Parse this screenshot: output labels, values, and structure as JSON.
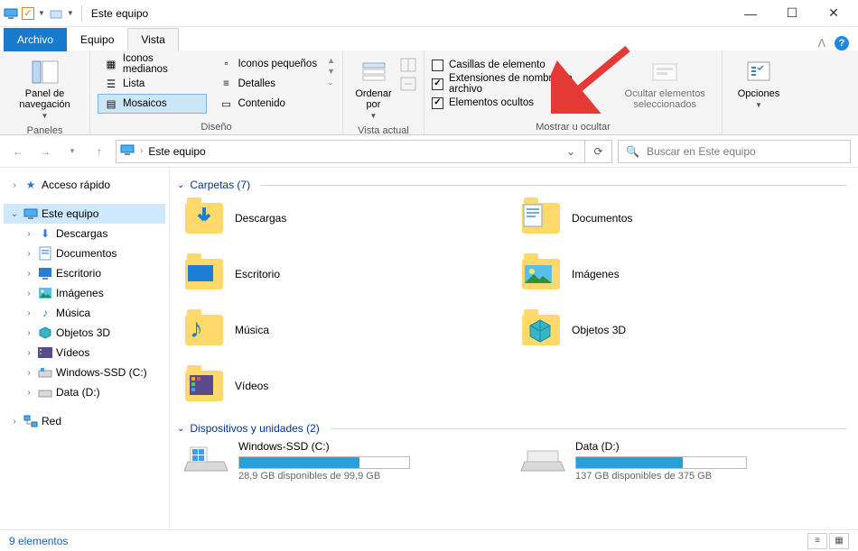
{
  "window": {
    "title": "Este equipo"
  },
  "tabs": {
    "file": "Archivo",
    "equipo": "Equipo",
    "vista": "Vista"
  },
  "ribbon": {
    "paneles": {
      "btn": "Panel de\nnavegación",
      "label": "Paneles"
    },
    "diseno": {
      "items": [
        "Iconos medianos",
        "Iconos pequeños",
        "Lista",
        "Detalles",
        "Mosaicos",
        "Contenido"
      ],
      "label": "Diseño"
    },
    "vista_actual": {
      "ordenar": "Ordenar\npor",
      "label": "Vista actual"
    },
    "mostrar": {
      "chk1": "Casillas de elemento",
      "chk2": "Extensiones de nombre de archivo",
      "chk3": "Elementos ocultos",
      "ocultar": "Ocultar elementos\nseleccionados",
      "label": "Mostrar u ocultar"
    },
    "opciones": "Opciones"
  },
  "nav": {
    "crumb": "Este equipo",
    "search_placeholder": "Buscar en Este equipo"
  },
  "tree": {
    "quick": "Acceso rápido",
    "pc": "Este equipo",
    "items": [
      "Descargas",
      "Documentos",
      "Escritorio",
      "Imágenes",
      "Música",
      "Objetos 3D",
      "Vídeos",
      "Windows-SSD (C:)",
      "Data (D:)"
    ],
    "red": "Red"
  },
  "sections": {
    "folders_hdr": "Carpetas (7)",
    "folders": [
      "Descargas",
      "Documentos",
      "Escritorio",
      "Imágenes",
      "Música",
      "Objetos 3D",
      "Vídeos"
    ],
    "drives_hdr": "Dispositivos y unidades (2)",
    "drives": [
      {
        "name": "Windows-SSD (C:)",
        "free": "28,9 GB disponibles de 99,9 GB",
        "pct": 71
      },
      {
        "name": "Data (D:)",
        "free": "137 GB disponibles de 375 GB",
        "pct": 63
      }
    ]
  },
  "status": {
    "count": "9 elementos"
  }
}
